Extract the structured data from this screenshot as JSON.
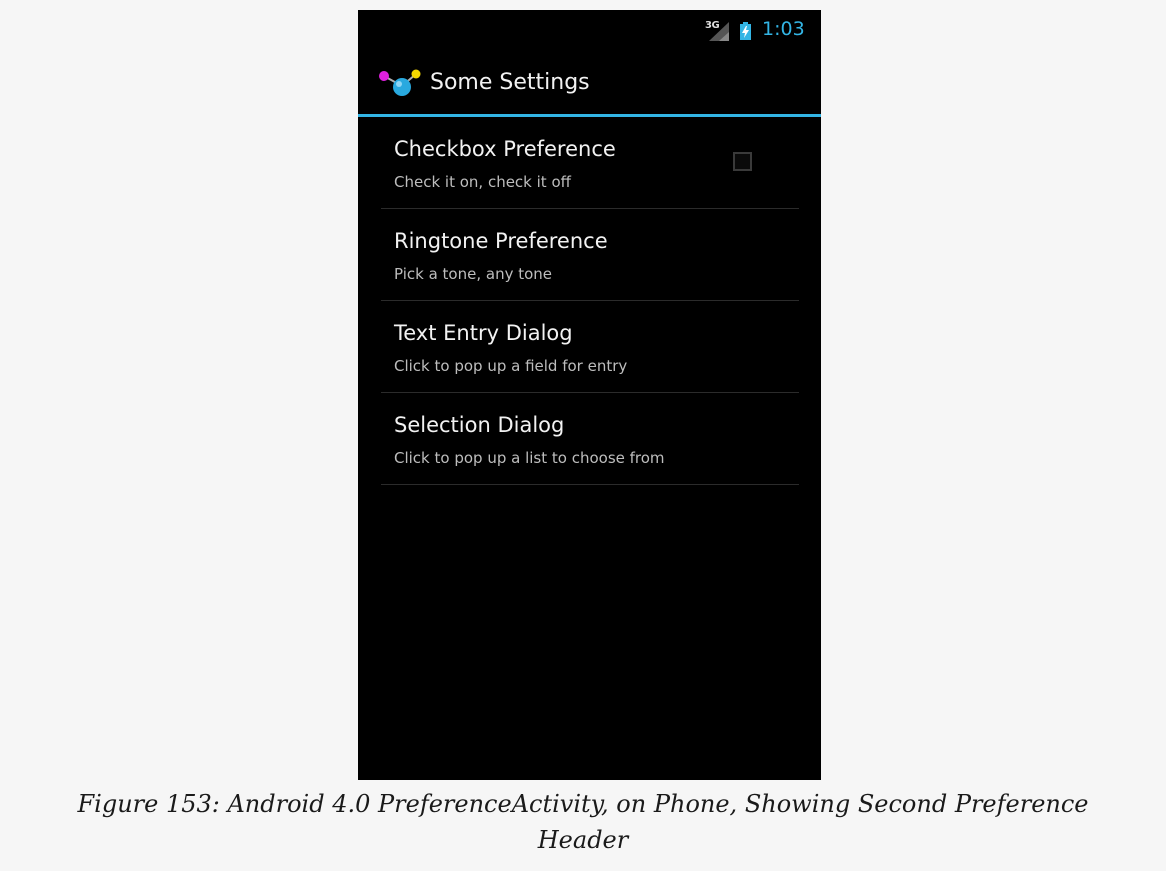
{
  "status_bar": {
    "network": "3G",
    "time": "1:03",
    "clock_color": "#33b5e5"
  },
  "action_bar": {
    "title": "Some Settings",
    "accent_color": "#33b5e5"
  },
  "preferences": [
    {
      "title": "Checkbox Preference",
      "summary": "Check it on, check it off",
      "widget": "checkbox",
      "checked": false
    },
    {
      "title": "Ringtone Preference",
      "summary": "Pick a tone, any tone"
    },
    {
      "title": "Text Entry Dialog",
      "summary": "Click to pop up a field for entry"
    },
    {
      "title": "Selection Dialog",
      "summary": "Click to pop up a list to choose from"
    }
  ],
  "caption": {
    "line1": "Figure 153: Android 4.0 PreferenceActivity, on Phone, Showing Second Preference",
    "line2": "Header"
  }
}
